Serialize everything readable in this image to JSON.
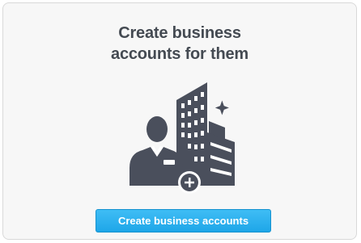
{
  "card": {
    "title": "Create business\naccounts for them",
    "illustration_icon": "person-with-buildings-plus-icon",
    "button_label": "Create business accounts"
  },
  "colors": {
    "card_background": "#f7f7f7",
    "card_border": "#d9d9d9",
    "title_text": "#444a52",
    "illustration_dark": "#4a4f5c",
    "button_top": "#3fbdf5",
    "button_bottom": "#1ea6e8",
    "button_text": "#ffffff"
  }
}
